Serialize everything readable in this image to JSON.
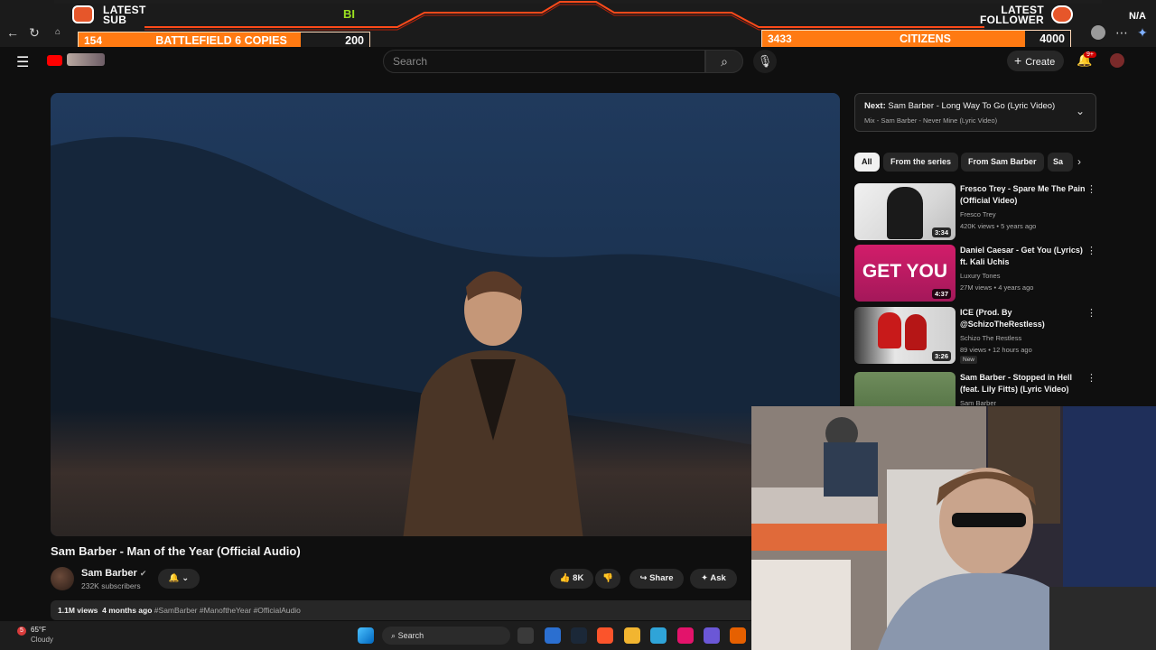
{
  "overlay": {
    "latest_sub_label": "LATEST\nSUB",
    "latest_sub_line1": "LATEST",
    "latest_sub_line2": "SUB",
    "latest_follower_line1": "LATEST",
    "latest_follower_line2": "FOLLOWER",
    "latest_follower_value": "N/A",
    "center_text": "BI",
    "goal_left": {
      "current": "154",
      "name": "BATTLEFIELD 6 COPIES",
      "target": "200",
      "progress": 0.77
    },
    "goal_right": {
      "current": "3433",
      "name": "CITIZENS",
      "target": "4000",
      "progress": 0.86
    }
  },
  "youtube": {
    "search_placeholder": "Search",
    "create_label": "Create",
    "notifications_badge": "9+",
    "video": {
      "title": "Sam Barber - Man of the Year (Official Audio)",
      "channel": "Sam Barber",
      "subscribers": "232K subscribers",
      "likes": "8K",
      "share_label": "Share",
      "ask_label": "Ask",
      "views": "1.1M views",
      "age": "4 months ago",
      "hashtags": "#SamBarber #ManoftheYear #OfficialAudio"
    },
    "next": {
      "label": "Next:",
      "title": "Sam Barber - Long Way To Go (Lyric Video)",
      "mix": "Mix - Sam Barber - Never Mine (Lyric Video)"
    },
    "chips": [
      "All",
      "From the series",
      "From Sam Barber",
      "Sa"
    ],
    "recommendations": [
      {
        "title": "Fresco Trey - Spare Me The Pain (Official Video)",
        "channel": "Fresco Trey",
        "meta": "420K views • 5 years ago",
        "duration": "3:34"
      },
      {
        "title": "Daniel Caesar - Get You (Lyrics) ft. Kali Uchis",
        "channel": "Luxury Tones",
        "meta": "27M views • 4 years ago",
        "duration": "4:37",
        "thumb_text": "GET YOU"
      },
      {
        "title": "ICE (Prod. By @SchizoTheRestless)",
        "channel": "Schizo The Restless",
        "meta": "89 views • 12 hours ago",
        "duration": "3:26",
        "badge": "New"
      },
      {
        "title": "Sam Barber - Stopped in Hell (feat. Lily Fitts) (Lyric Video)",
        "channel": "Sam Barber"
      }
    ]
  },
  "taskbar": {
    "weather_badge": "5",
    "temperature": "65°F",
    "condition": "Cloudy",
    "search_label": "Search"
  },
  "colors": {
    "youtube_red": "#ff0000",
    "overlay_orange": "#ff7a12",
    "background": "#0f0f0f"
  }
}
